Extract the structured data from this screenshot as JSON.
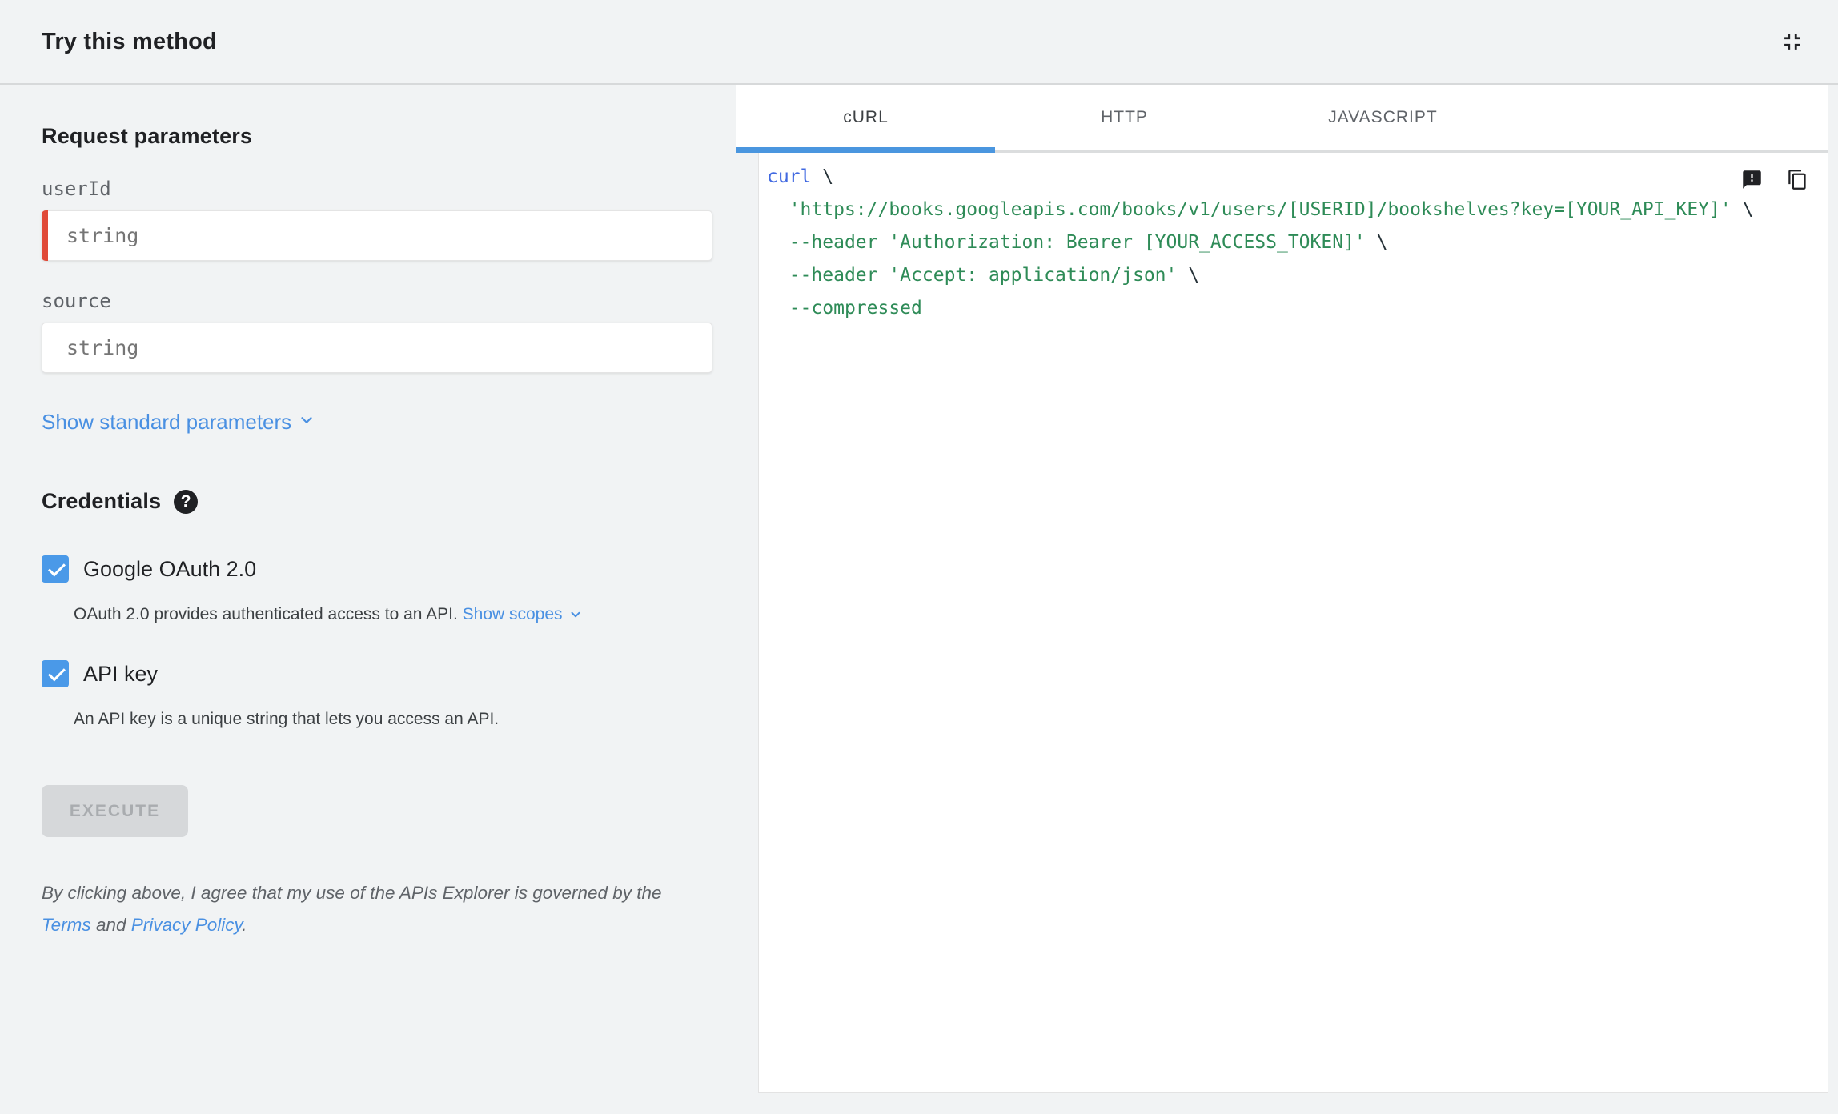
{
  "header": {
    "title": "Try this method"
  },
  "request_parameters": {
    "title": "Request parameters",
    "fields": [
      {
        "label": "userId",
        "placeholder": "string",
        "value": "",
        "required": true
      },
      {
        "label": "source",
        "placeholder": "string",
        "value": "",
        "required": false
      }
    ],
    "show_standard_parameters_label": "Show standard parameters"
  },
  "credentials": {
    "title": "Credentials",
    "options": [
      {
        "label": "Google OAuth 2.0",
        "checked": true,
        "description": "OAuth 2.0 provides authenticated access to an API. ",
        "link_label": "Show scopes"
      },
      {
        "label": "API key",
        "checked": true,
        "description": "An API key is a unique string that lets you access an API.",
        "link_label": ""
      }
    ]
  },
  "execute": {
    "label": "EXECUTE",
    "disabled": true
  },
  "disclaimer": {
    "prefix": "By clicking above, I agree that my use of the APIs Explorer is governed by the ",
    "terms_label": "Terms",
    "middle": " and ",
    "privacy_label": "Privacy Policy",
    "suffix": "."
  },
  "tabs": [
    {
      "label": "cURL",
      "active": true
    },
    {
      "label": "HTTP",
      "active": false
    },
    {
      "label": "JAVASCRIPT",
      "active": false
    }
  ],
  "code": {
    "lines": [
      [
        {
          "type": "keyword",
          "text": "curl"
        },
        {
          "type": "plain",
          "text": " \\"
        }
      ],
      [
        {
          "type": "plain",
          "text": "  "
        },
        {
          "type": "string",
          "text": "'https://books.googleapis.com/books/v1/users/[USERID]/bookshelves?key=[YOUR_API_KEY]'"
        },
        {
          "type": "plain",
          "text": " \\"
        }
      ],
      [
        {
          "type": "plain",
          "text": "  "
        },
        {
          "type": "flag",
          "text": "--header"
        },
        {
          "type": "string",
          "text": " 'Authorization: Bearer [YOUR_ACCESS_TOKEN]'"
        },
        {
          "type": "plain",
          "text": " \\"
        }
      ],
      [
        {
          "type": "plain",
          "text": "  "
        },
        {
          "type": "flag",
          "text": "--header"
        },
        {
          "type": "string",
          "text": " 'Accept: application/json'"
        },
        {
          "type": "plain",
          "text": " \\"
        }
      ],
      [
        {
          "type": "plain",
          "text": "  "
        },
        {
          "type": "flag",
          "text": "--compressed"
        }
      ]
    ]
  },
  "colors": {
    "accent_blue": "#4A96DF",
    "link_blue": "#4A90E2",
    "checkbox_blue": "#4A99E8",
    "required_red": "#E04A38",
    "code_keyword_blue": "#4169E1",
    "code_string_green": "#2E8B57",
    "panel_gray": "#F1F3F4"
  }
}
